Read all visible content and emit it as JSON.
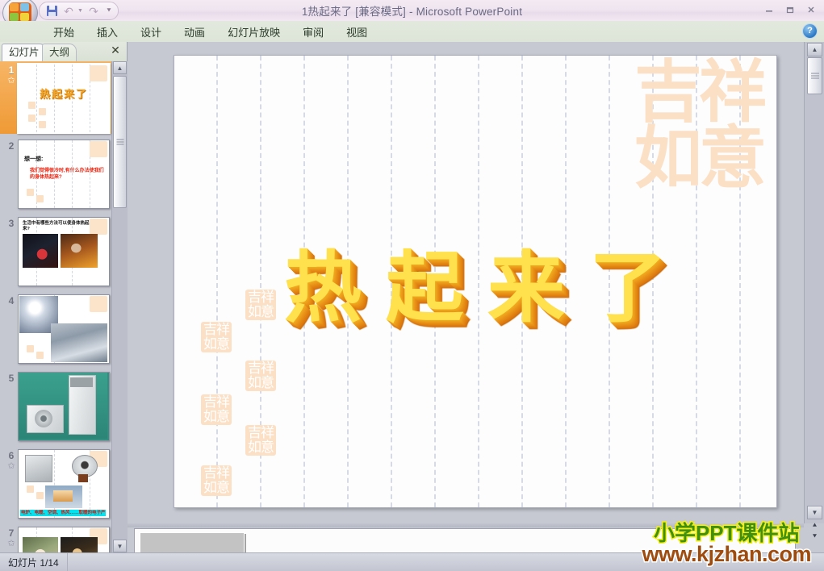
{
  "window": {
    "title": "1热起来了 [兼容模式] - Microsoft PowerPoint",
    "minimize_label": "最小化",
    "restore_label": "还原",
    "close_label": "关闭",
    "help_label": "?"
  },
  "quick_access": {
    "save_label": "保存",
    "undo_label": "撤消",
    "undo_more_label": "▾",
    "redo_label": "恢复",
    "customize_label": "▾"
  },
  "ribbon": {
    "tabs": [
      {
        "label": "开始"
      },
      {
        "label": "插入"
      },
      {
        "label": "设计"
      },
      {
        "label": "动画"
      },
      {
        "label": "幻灯片放映"
      },
      {
        "label": "审阅"
      },
      {
        "label": "视图"
      }
    ]
  },
  "left_pane": {
    "tab_slides": "幻灯片",
    "tab_outline": "大纲",
    "close_label": "✕",
    "scroll_up": "▲",
    "scroll_down": "▼",
    "thumbnails": [
      {
        "number": "1",
        "animated": true,
        "title": "热起来了"
      },
      {
        "number": "2",
        "animated": false,
        "heading": "想一想:",
        "body": "我们觉得很冷时,有什么办法使我们的身体热起来?"
      },
      {
        "number": "3",
        "animated": false,
        "heading": "生活中有哪些方法可以使身体热起来?"
      },
      {
        "number": "4",
        "animated": false
      },
      {
        "number": "5",
        "animated": false
      },
      {
        "number": "6",
        "animated": true,
        "caption": "电炉、电暖、空调、热风……取暖的电子产品"
      },
      {
        "number": "7",
        "animated": true
      }
    ]
  },
  "slide": {
    "title": "热起来了",
    "seal_watermark": "吉祥如意",
    "small_seal": "吉祥如意",
    "title_color": "#ffe14d",
    "title_shadow_color": "#e08813",
    "seal_color": "#fce0c6"
  },
  "edit_scroll": {
    "up": "▲",
    "down": "▼",
    "previous_slide": "⯅",
    "next_slide": "⯆"
  },
  "notes": {
    "placeholder": ""
  },
  "status_bar": {
    "slide_counter": "幻灯片 1/14"
  },
  "site_watermark": {
    "line1": "小学PPT课件站",
    "line2": "www.kjzhan.com",
    "line1_color": "#3f8f12",
    "line1_stroke": "#f5ee18",
    "line2_color": "#9e4b10"
  }
}
